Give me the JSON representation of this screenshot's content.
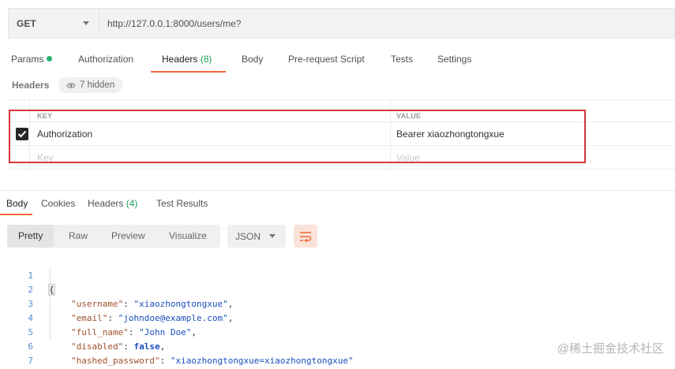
{
  "request": {
    "method": "GET",
    "url": "http://127.0.0.1:8000/users/me?"
  },
  "request_tabs": [
    {
      "label": "Params"
    },
    {
      "label": "Authorization"
    },
    {
      "label": "Headers",
      "count": "(8)"
    },
    {
      "label": "Body"
    },
    {
      "label": "Pre-request Script"
    },
    {
      "label": "Tests"
    },
    {
      "label": "Settings"
    }
  ],
  "headers_section": {
    "title": "Headers",
    "hidden_label": "7 hidden",
    "columns": {
      "key": "KEY",
      "value": "VALUE"
    },
    "rows": [
      {
        "checked": true,
        "key": "Authorization",
        "value": "Bearer xiaozhongtongxue"
      }
    ],
    "placeholder": {
      "key": "Key",
      "value": "Value"
    }
  },
  "response_tabs": [
    {
      "label": "Body"
    },
    {
      "label": "Cookies"
    },
    {
      "label": "Headers",
      "count": "(4)"
    },
    {
      "label": "Test Results"
    }
  ],
  "view_modes": [
    "Pretty",
    "Raw",
    "Preview",
    "Visualize"
  ],
  "format": "JSON",
  "code": {
    "line_numbers": [
      "1",
      "2",
      "3",
      "4",
      "5",
      "6",
      "7"
    ],
    "open_brace": "{",
    "close_brace": "}",
    "fields": [
      {
        "key": "\"username\"",
        "value": "\"xiaozhongtongxue\"",
        "comma": ","
      },
      {
        "key": "\"email\"",
        "value": "\"johndoe@example.com\"",
        "comma": ","
      },
      {
        "key": "\"full_name\"",
        "value": "\"John Doe\"",
        "comma": ","
      },
      {
        "key": "\"disabled\"",
        "value": "false",
        "comma": ","
      },
      {
        "key": "\"hashed_password\"",
        "value": "\"xiaozhongtongxue=xiaozhongtongxue\"",
        "comma": ""
      }
    ]
  },
  "watermark": "@稀土掘金技术社区",
  "colors": {
    "accent": "#f26b3a",
    "count_green": "#20a05a",
    "highlight_red": "#d9363e"
  }
}
